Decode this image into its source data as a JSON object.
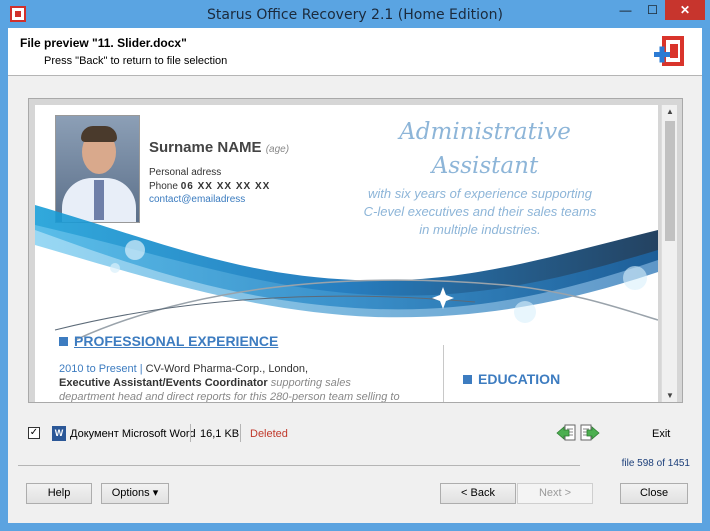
{
  "window": {
    "title": "Starus Office Recovery 2.1 (Home Edition)",
    "min_glyph": "—",
    "max_glyph": "☐",
    "close_glyph": "✕"
  },
  "header": {
    "title": "File preview \"11. Slider.docx\"",
    "subtitle": "Press \"Back\" to return to file selection"
  },
  "document": {
    "name": "Surname NAME",
    "name_hint": "(age)",
    "address": "Personal adress",
    "phone_label": "Phone",
    "phone_number": "06 XX XX XX XX",
    "email": "contact@emailadress",
    "headline_1": "Administrative",
    "headline_2": "Assistant",
    "subline_1": "with six years of experience supporting",
    "subline_2": "C-level executives and their sales teams",
    "subline_3": "in multiple industries.",
    "section_experience": "PROFESSIONAL EXPERIENCE",
    "exp_years": "2010 to Present |",
    "exp_company": " CV-Word Pharma-Corp., London,",
    "exp_role": "Executive Assistant/Events Coordinator",
    "exp_role_desc": " supporting sales",
    "exp_line3": "department head and direct reports for this 280-person team selling to",
    "section_education": "EDUCATION"
  },
  "file_info": {
    "checked_glyph": "✓",
    "word_icon_letter": "W",
    "type": "Документ Microsoft Word",
    "size": "16,1 KB",
    "status": "Deleted",
    "exit_label": "Exit",
    "counter": "file 598 of 1451"
  },
  "buttons": {
    "help": "Help",
    "options": "Options ▾",
    "back": "< Back",
    "next": "Next >",
    "close": "Close"
  },
  "colors": {
    "titlebar": "#5aa4e2",
    "accent_blue": "#3d7cc0",
    "deleted_red": "#c0392b",
    "nav_green": "#4caf50"
  },
  "icons": [
    "app-icon",
    "office-recovery-logo",
    "word-doc-icon",
    "prev-file-icon",
    "next-file-icon"
  ]
}
